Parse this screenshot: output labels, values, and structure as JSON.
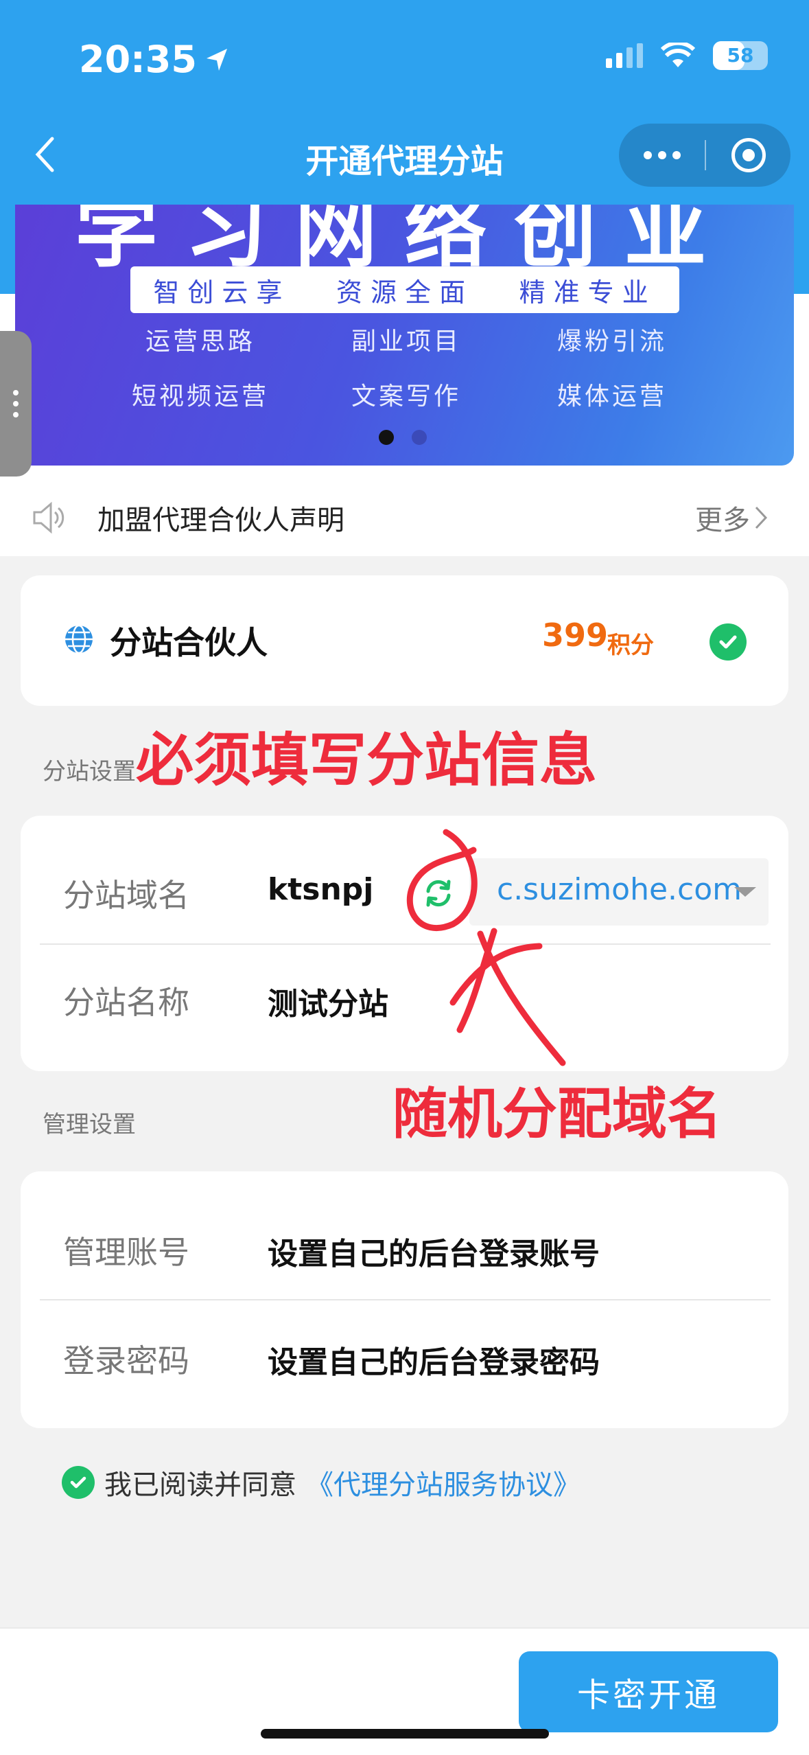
{
  "status_bar": {
    "time": "20:35",
    "battery": "58",
    "battery_level": 0.58
  },
  "nav": {
    "title": "开通代理分站"
  },
  "banner": {
    "headline": "学习网络创业",
    "strip": [
      "智创云享",
      "资源全面",
      "精准专业"
    ],
    "tags": [
      "运营思路",
      "副业项目",
      "爆粉引流",
      "短视频运营",
      "文案写作",
      "媒体运营"
    ],
    "active_dot": 0,
    "dot_count": 2
  },
  "notice": {
    "text": "加盟代理合伙人声明",
    "more": "更多"
  },
  "partner": {
    "label": "分站合伙人",
    "price": "399",
    "unit": "积分"
  },
  "site_settings": {
    "section_title": "分站设置",
    "domain_label": "分站域名",
    "domain_value": "ktsnpj",
    "domain_suffix": "c.suzimohe.com",
    "name_label": "分站名称",
    "name_value": "测试分站"
  },
  "admin_settings": {
    "section_title": "管理设置",
    "account_label": "管理账号",
    "account_value": "设置自己的后台登录账号",
    "password_label": "登录密码",
    "password_value": "设置自己的后台登录密码"
  },
  "agreement": {
    "text": "我已阅读并同意",
    "link": "《代理分站服务协议》"
  },
  "footer": {
    "submit": "卡密开通"
  },
  "annotations": {
    "top": "必须填写分站信息",
    "bottom": "随机分配域名",
    "color": "#ee2c3c"
  },
  "colors": {
    "primary": "#2da2ef",
    "accent_orange": "#f06a10",
    "success": "#1fbf6a",
    "link": "#2d8fe0"
  }
}
